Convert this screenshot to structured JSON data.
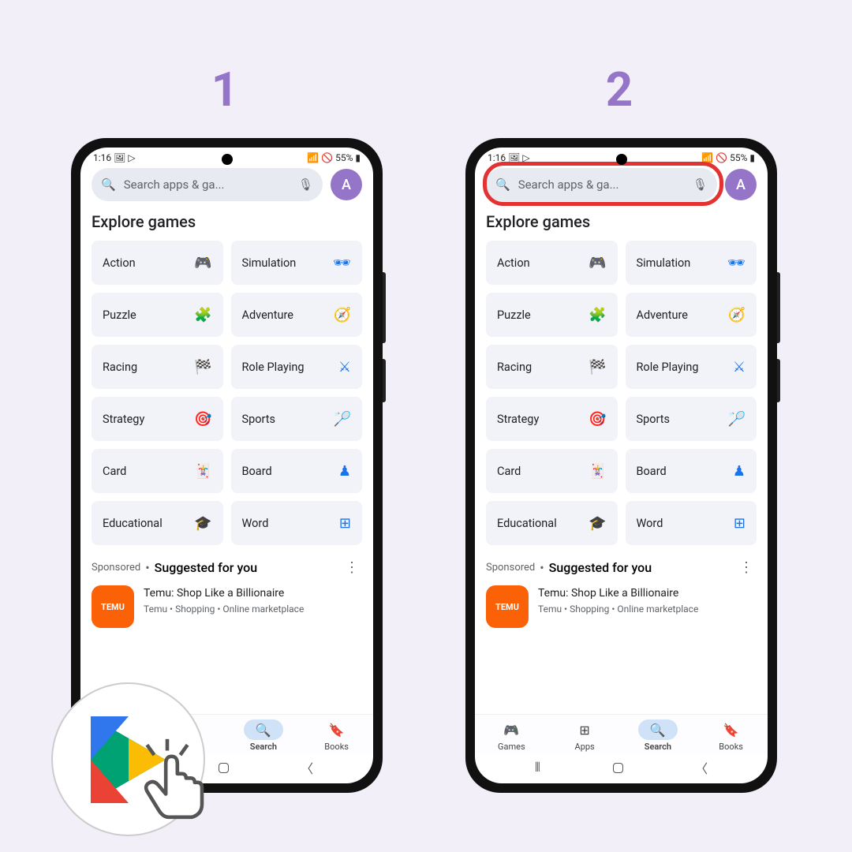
{
  "steps": {
    "one": "1",
    "two": "2"
  },
  "status": {
    "time": "1:16",
    "battery": "55%"
  },
  "search": {
    "placeholder": "Search apps & ga..."
  },
  "avatar": {
    "letter": "A"
  },
  "heading": "Explore games",
  "categories": [
    {
      "label": "Action"
    },
    {
      "label": "Simulation"
    },
    {
      "label": "Puzzle"
    },
    {
      "label": "Adventure"
    },
    {
      "label": "Racing"
    },
    {
      "label": "Role Playing"
    },
    {
      "label": "Strategy"
    },
    {
      "label": "Sports"
    },
    {
      "label": "Card"
    },
    {
      "label": "Board"
    },
    {
      "label": "Educational"
    },
    {
      "label": "Word"
    }
  ],
  "suggested": {
    "sponsored": "Sponsored",
    "title": "Suggested for you",
    "app": {
      "icon_text": "TEMU",
      "name": "Temu: Shop Like a Billionaire",
      "meta": "Temu • Shopping • Online marketplace"
    }
  },
  "nav": {
    "games": "Games",
    "apps": "Apps",
    "search": "Search",
    "books": "Books"
  }
}
